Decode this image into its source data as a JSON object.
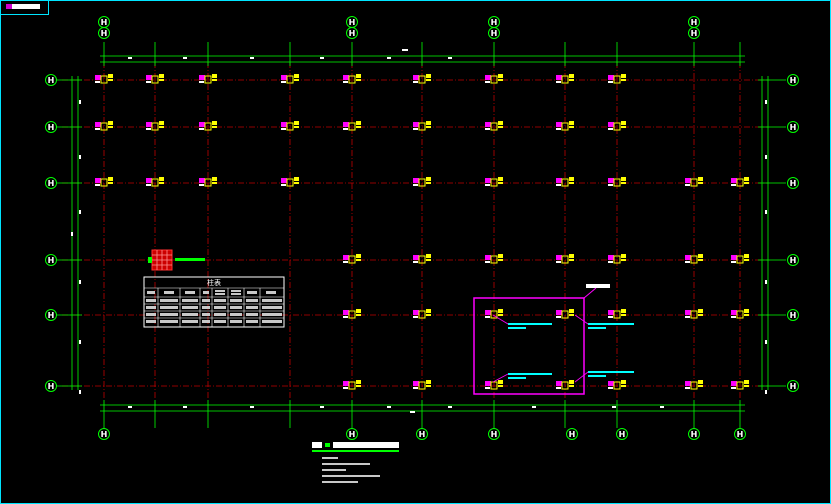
{
  "colors": {
    "background": "#000000",
    "frame": "#00e5ff",
    "grid_line": "#c00000",
    "dimension": "#00ff00",
    "column": "#ffff00",
    "column_tag": "#ff00ff",
    "highlight_box": "#ff00ff",
    "note_text": "#00ffff",
    "table_border": "#ffffff",
    "legend_mark": "#ff0000"
  },
  "icons": [
    "axis-bubble-icon",
    "column-footing-icon",
    "column-detail-icon"
  ],
  "drawing": {
    "axis_bubble_glyph": "H",
    "table_title": "柱表"
  }
}
